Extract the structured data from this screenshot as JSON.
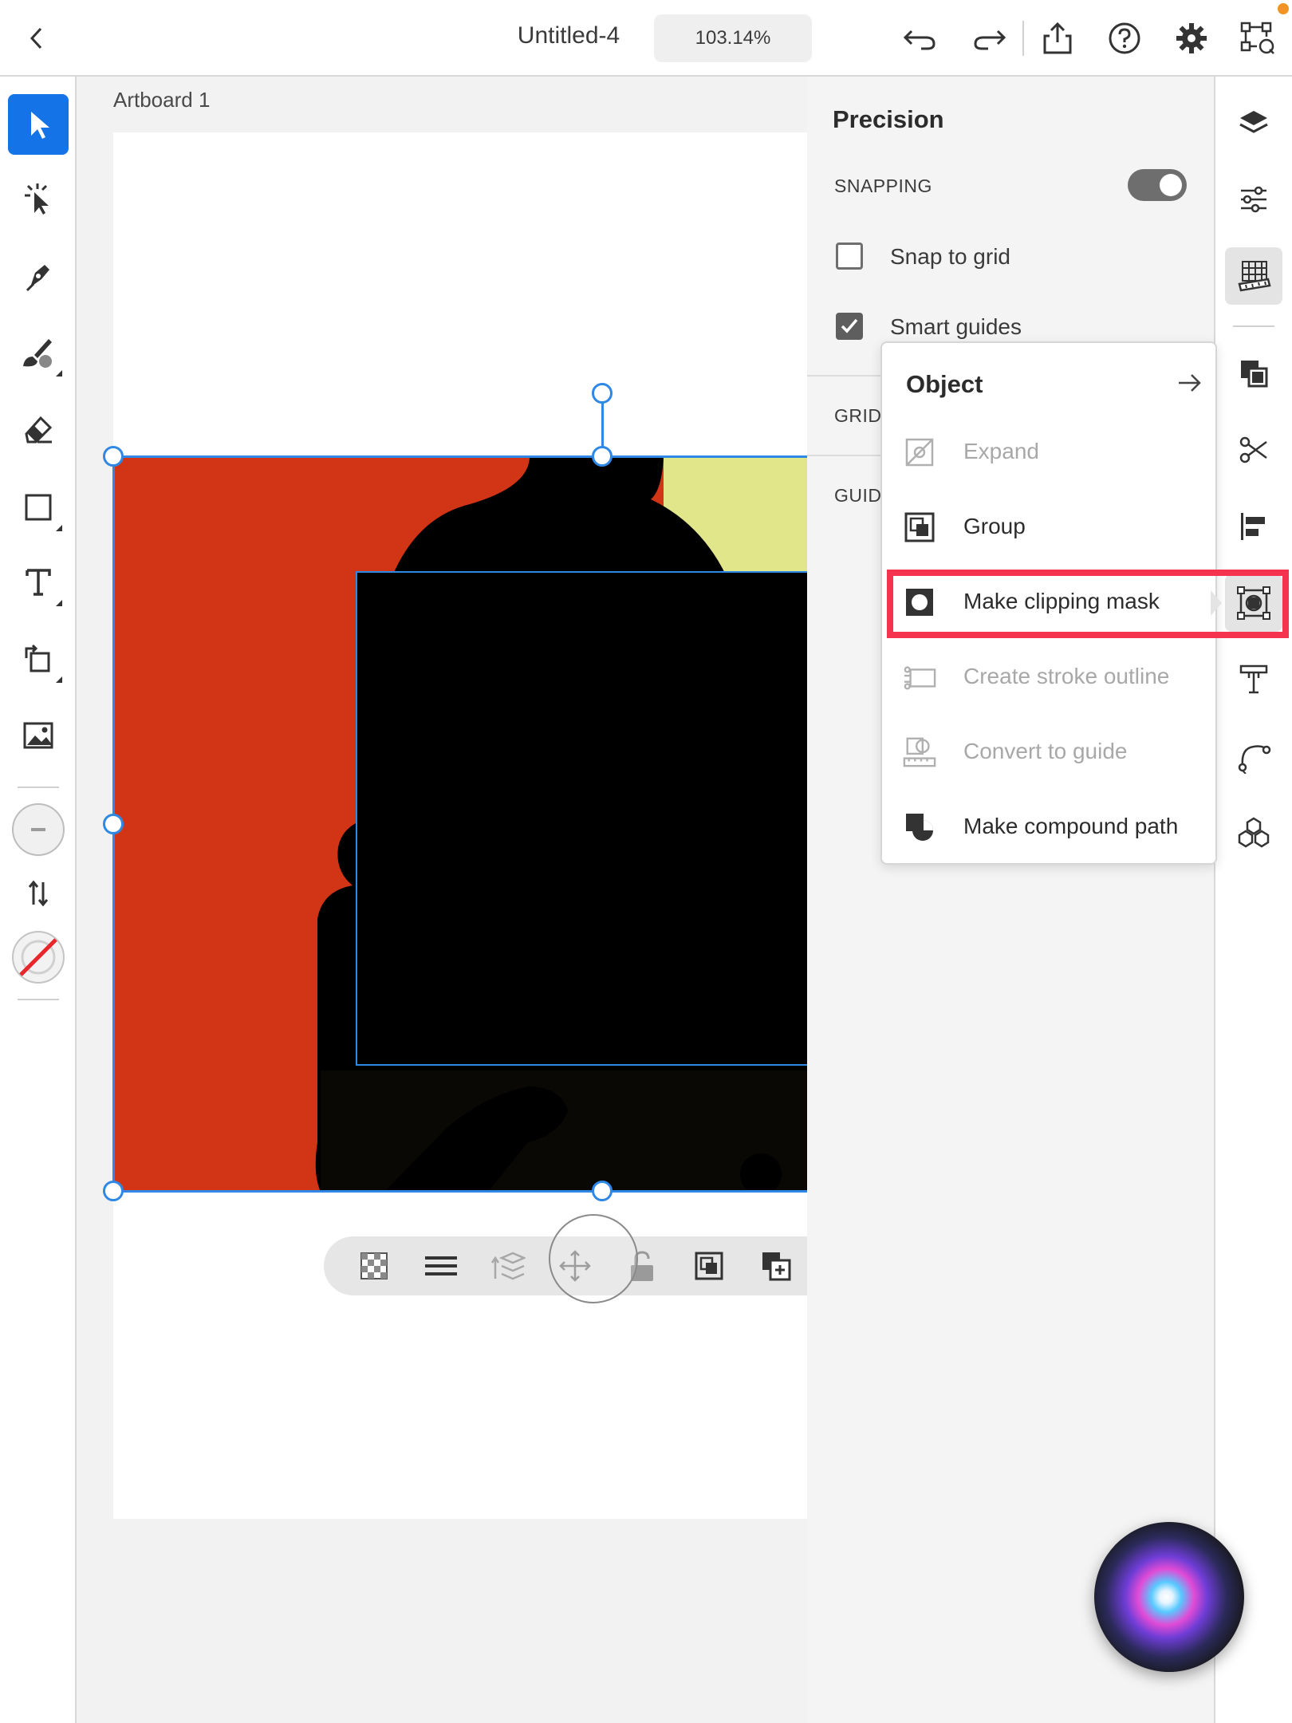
{
  "header": {
    "back_icon": "chevron-left-icon",
    "title": "Untitled-4",
    "zoom": "103.14%",
    "icons": [
      "undo-icon",
      "redo-icon",
      "share-icon",
      "help-icon",
      "gear-icon",
      "transform-icon"
    ]
  },
  "left_toolbar": {
    "tools": [
      "select-tool",
      "direct-select-tool",
      "pen-tool",
      "paintbrush-tool",
      "eraser-tool",
      "rectangle-tool",
      "type-tool",
      "rotate-tool",
      "place-image-tool",
      "fill-swatch",
      "swap-icon",
      "stroke-swatch"
    ]
  },
  "canvas": {
    "artboard_label": "Artboard 1"
  },
  "precision_panel": {
    "title": "Precision",
    "snapping_label": "SNAPPING",
    "snapping_on": true,
    "snap_to_grid_label": "Snap to grid",
    "snap_to_grid_checked": false,
    "smart_guides_label": "Smart guides",
    "smart_guides_checked": true,
    "grid_label": "GRID",
    "guides_label": "GUID"
  },
  "object_menu": {
    "title": "Object",
    "items": [
      {
        "label": "Expand",
        "enabled": false,
        "icon": "expand-icon"
      },
      {
        "label": "Group",
        "enabled": true,
        "icon": "group-icon"
      },
      {
        "label": "Make clipping mask",
        "enabled": true,
        "icon": "clipping-mask-icon",
        "highlighted": true
      },
      {
        "label": "Create stroke outline",
        "enabled": false,
        "icon": "stroke-outline-icon"
      },
      {
        "label": "Convert to guide",
        "enabled": false,
        "icon": "convert-guide-icon"
      },
      {
        "label": "Make compound path",
        "enabled": true,
        "icon": "compound-path-icon"
      }
    ]
  },
  "right_rail": {
    "icons": [
      "layers-icon",
      "properties-icon",
      "precision-icon",
      "arrange-icon",
      "scissors-icon",
      "align-icon",
      "object-icon",
      "text-icon",
      "path-icon",
      "repeat-grid-icon"
    ]
  },
  "colors": {
    "accent": "#1473e6",
    "selection": "#2f87e6",
    "image_red": "#d23516",
    "image_yellow": "#e1e68a",
    "highlight": "#f5334f"
  }
}
